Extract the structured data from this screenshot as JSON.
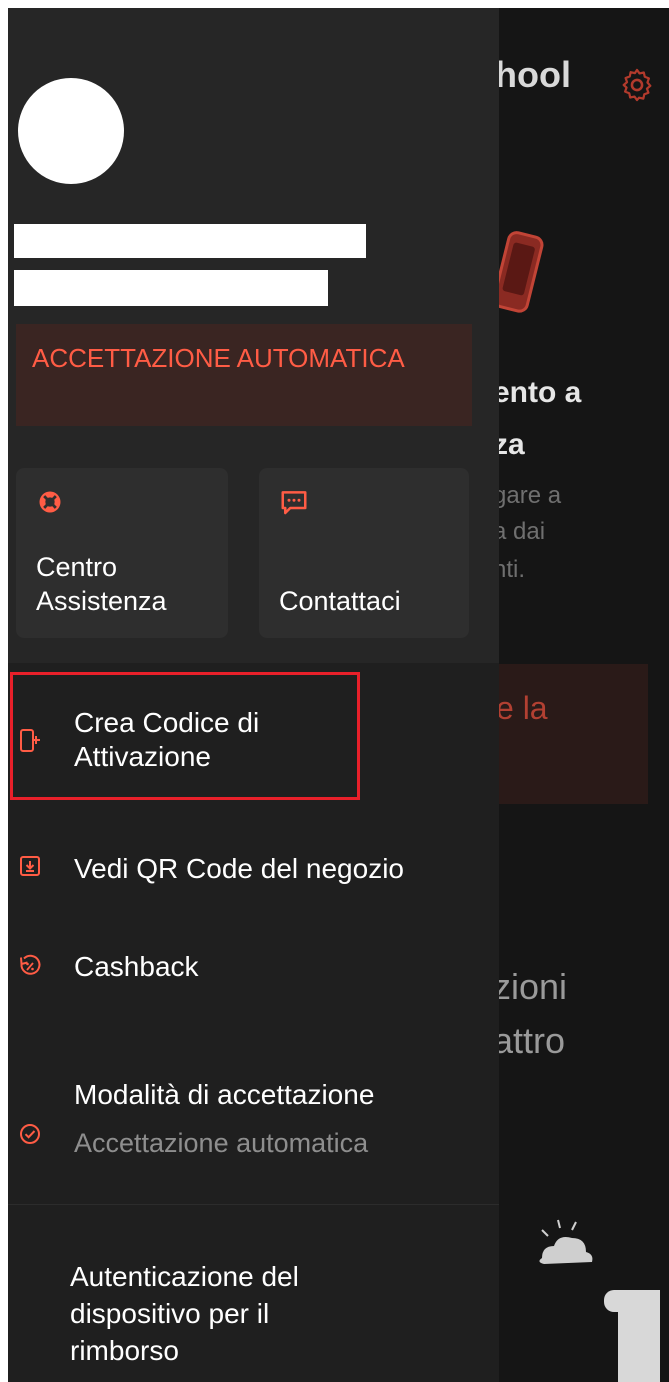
{
  "background_app": {
    "title_fragment": "hool",
    "heading_fragment_1": "ento a",
    "heading_fragment_2": "za",
    "sub_fragment_1": "gare a",
    "sub_fragment_2": "a dai",
    "sub_fragment_3": "nti.",
    "button_fragment": "e la",
    "section_fragment_1": "zioni",
    "section_fragment_2": "attro"
  },
  "drawer": {
    "auto_accept_banner": "ACCETTAZIONE AUTOMATICA",
    "tiles": [
      {
        "label": "Centro Assistenza",
        "icon": "lifebuoy-icon"
      },
      {
        "label": "Contattaci",
        "icon": "chat-icon"
      }
    ],
    "menu": [
      {
        "label": "Crea Codice di Attivazione",
        "icon": "device-add-icon"
      },
      {
        "label": "Vedi QR Code del negozio",
        "icon": "download-box-icon"
      },
      {
        "label": "Cashback",
        "icon": "cashback-percent-icon"
      },
      {
        "label": "Modalità di accettazione",
        "sub": "Accettazione automatica",
        "icon": "check-circle-icon"
      },
      {
        "label": "Autenticazione del dispositivo per il rimborso"
      }
    ]
  },
  "colors": {
    "accent": "#ff5c45",
    "highlight_border": "#e8202a",
    "drawer_bg": "#1f1f1f",
    "header_bg": "#262626"
  }
}
